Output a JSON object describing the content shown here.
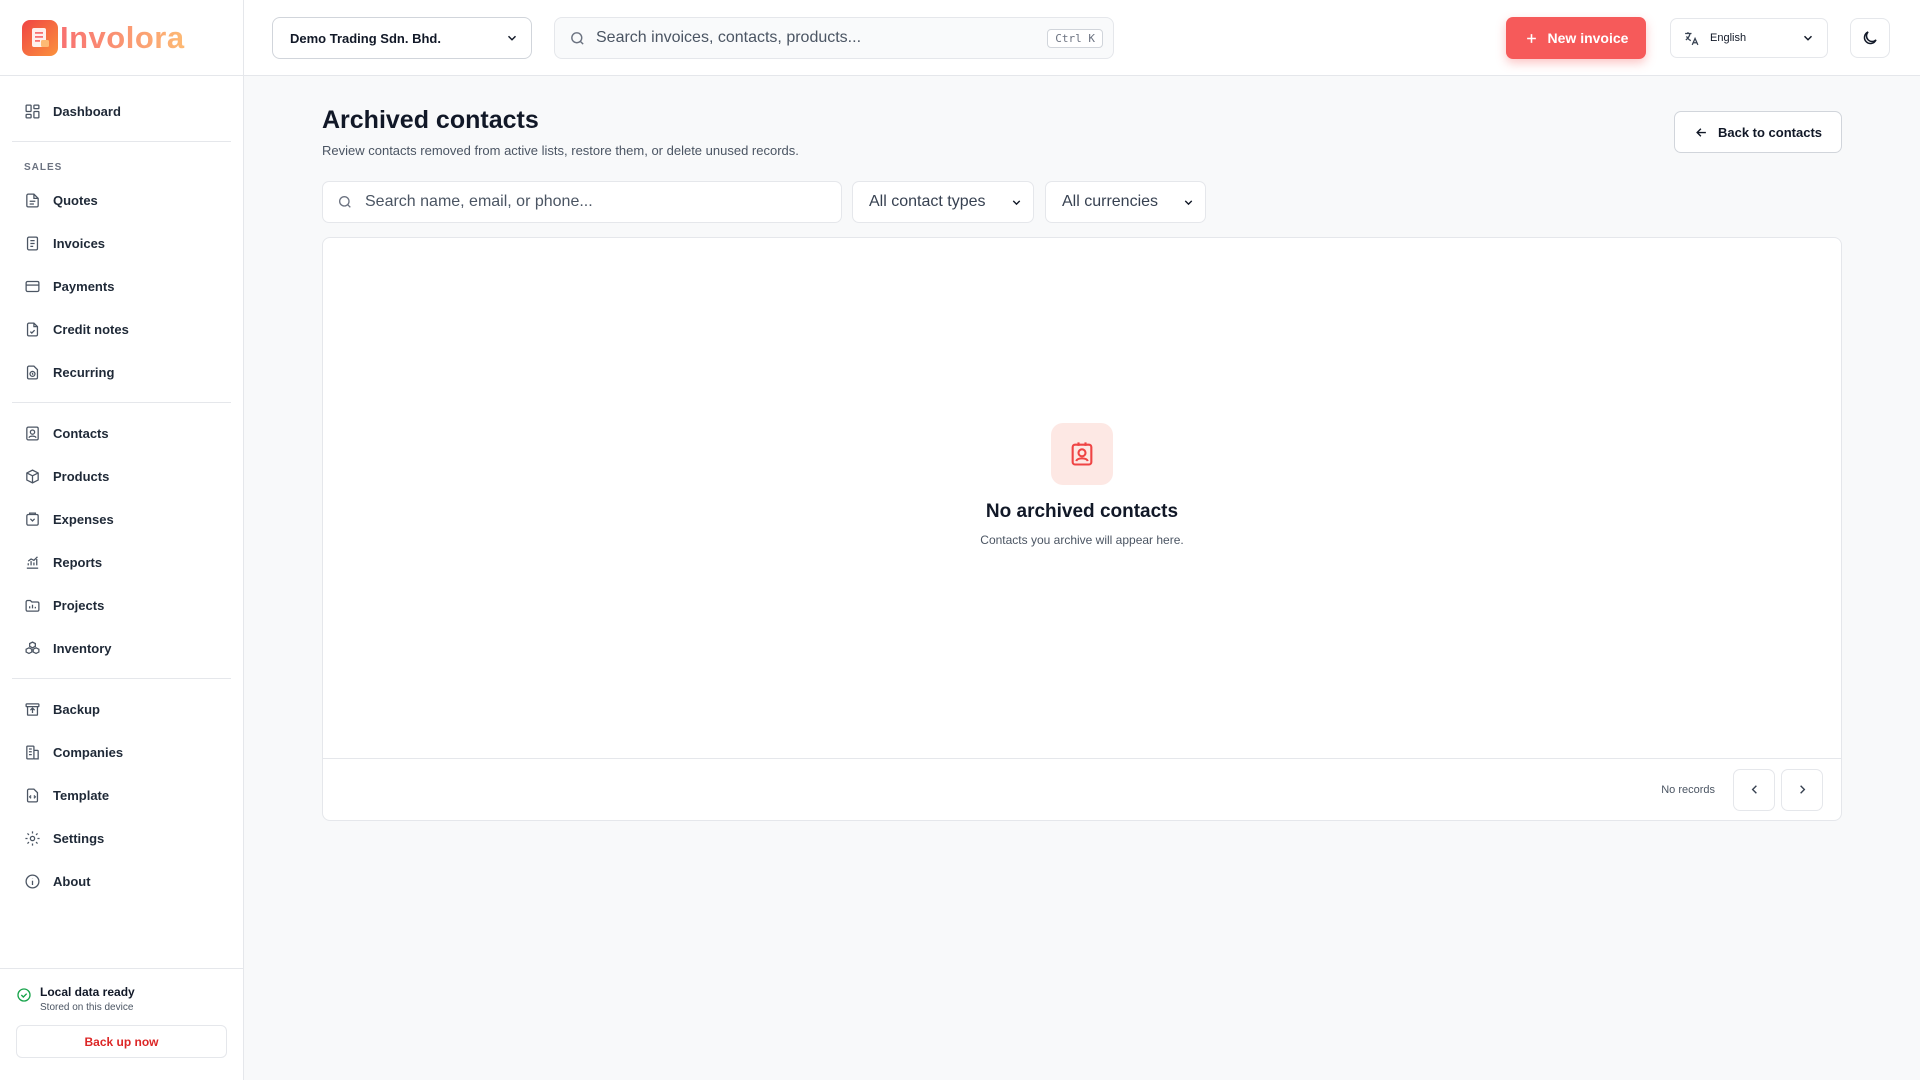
{
  "brand": {
    "name": "Involora",
    "logo_icon": "invoice-logo-icon"
  },
  "sidebar": {
    "top_items": [
      {
        "label": "Dashboard",
        "icon": "dashboard-icon"
      }
    ],
    "sales_section": "SALES",
    "sales_items": [
      {
        "label": "Quotes",
        "icon": "quote-icon"
      },
      {
        "label": "Invoices",
        "icon": "invoice-icon"
      },
      {
        "label": "Payments",
        "icon": "credit-card-icon"
      },
      {
        "label": "Credit notes",
        "icon": "credit-note-icon"
      },
      {
        "label": "Recurring",
        "icon": "recurring-icon"
      }
    ],
    "mid_items": [
      {
        "label": "Contacts",
        "icon": "contact-icon"
      },
      {
        "label": "Products",
        "icon": "box-icon"
      },
      {
        "label": "Expenses",
        "icon": "wallet-icon"
      },
      {
        "label": "Reports",
        "icon": "chart-icon"
      },
      {
        "label": "Projects",
        "icon": "folder-icon"
      },
      {
        "label": "Inventory",
        "icon": "boxes-icon"
      }
    ],
    "bottom_items": [
      {
        "label": "Backup",
        "icon": "archive-icon"
      },
      {
        "label": "Companies",
        "icon": "building-icon"
      },
      {
        "label": "Template",
        "icon": "template-icon"
      },
      {
        "label": "Settings",
        "icon": "gear-icon"
      },
      {
        "label": "About",
        "icon": "info-icon"
      }
    ],
    "footer": {
      "status_title": "Local data ready",
      "status_sub": "Stored on this device",
      "backup_label": "Back up now"
    }
  },
  "topbar": {
    "company": "Demo Trading Sdn. Bhd.",
    "search_placeholder": "Search invoices, contacts, products...",
    "search_shortcut": "Ctrl K",
    "new_invoice_label": "New invoice",
    "language": "English"
  },
  "page": {
    "title": "Archived contacts",
    "subtitle": "Review contacts removed from active lists, restore them, or delete unused records.",
    "back_label": "Back to contacts",
    "filter_search_placeholder": "Search name, email, or phone...",
    "contact_type_select": "All contact types",
    "currency_select": "All currencies",
    "empty_title": "No archived contacts",
    "empty_sub": "Contacts you archive will appear here.",
    "records_label": "No records"
  },
  "colors": {
    "accent": "#f65a5a",
    "accent_soft": "#fde8e4",
    "success": "#16a34a",
    "danger": "#dc2626"
  }
}
